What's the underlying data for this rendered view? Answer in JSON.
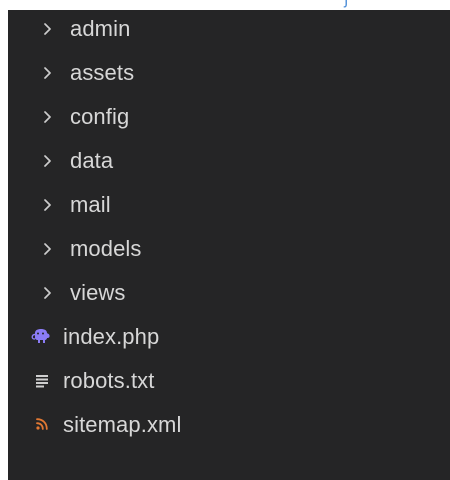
{
  "colors": {
    "panel_background": "#252526",
    "text": "#d7d7d7",
    "chevron": "#cccccc",
    "php": "#8b7cf6",
    "rss": "#e37933",
    "text_icon": "#cfcfcf",
    "top_fragment": "#4f8fd8"
  },
  "explorer": {
    "items": [
      {
        "label": "admin",
        "kind": "folder",
        "icon": "chevron-right-icon"
      },
      {
        "label": "assets",
        "kind": "folder",
        "icon": "chevron-right-icon"
      },
      {
        "label": "config",
        "kind": "folder",
        "icon": "chevron-right-icon"
      },
      {
        "label": "data",
        "kind": "folder",
        "icon": "chevron-right-icon"
      },
      {
        "label": "mail",
        "kind": "folder",
        "icon": "chevron-right-icon"
      },
      {
        "label": "models",
        "kind": "folder",
        "icon": "chevron-right-icon"
      },
      {
        "label": "views",
        "kind": "folder",
        "icon": "chevron-right-icon"
      },
      {
        "label": "index.php",
        "kind": "file",
        "icon": "php-file-icon"
      },
      {
        "label": "robots.txt",
        "kind": "file",
        "icon": "text-file-icon"
      },
      {
        "label": "sitemap.xml",
        "kind": "file",
        "icon": "rss-file-icon"
      }
    ]
  }
}
